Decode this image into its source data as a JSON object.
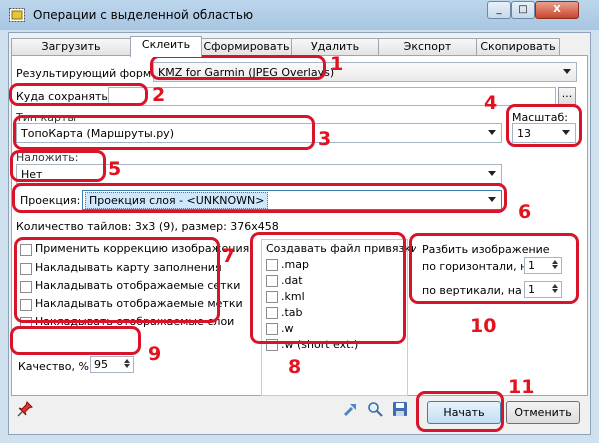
{
  "window": {
    "title": "Операции с выделенной областью",
    "min_btn": "_",
    "max_btn": "□",
    "close_btn": "X"
  },
  "tabs": [
    {
      "label": "Загрузить",
      "active": false
    },
    {
      "label": "Склеить",
      "active": true
    },
    {
      "label": "Сформировать",
      "active": false
    },
    {
      "label": "Удалить",
      "active": false
    },
    {
      "label": "Экспорт",
      "active": false
    },
    {
      "label": "Скопировать",
      "active": false
    }
  ],
  "format": {
    "label": "Результирующий формат",
    "value": "KMZ for Garmin (JPEG Overlays)"
  },
  "save": {
    "label": "Куда сохранять:",
    "value": "",
    "browse": "..."
  },
  "map_type": {
    "label": "Тип карты",
    "value": "ТопоКарта (Маршруты.ру)"
  },
  "scale": {
    "label": "Масштаб:",
    "value": "13"
  },
  "overlay": {
    "label": "Наложить:",
    "value": "Нет"
  },
  "projection": {
    "label": "Проекция:",
    "value": "Проекция слоя - <UNKNOWN>"
  },
  "tiles_info": "Количество тайлов: 3x3 (9), размер: 376x458",
  "options": [
    {
      "label": "Применить коррекцию изображения",
      "checked": false
    },
    {
      "label": "Накладывать карту заполнения",
      "checked": false
    },
    {
      "label": "Накладывать отображаемые сетки",
      "checked": false
    },
    {
      "label": "Накладывать отображаемые метки",
      "checked": false
    },
    {
      "label": "Накладывать отображаемые слои",
      "checked": false
    }
  ],
  "quality": {
    "label": "Качество, %",
    "value": "95"
  },
  "georef": {
    "title": "Создавать файл привязки:",
    "items": [
      {
        "label": ".map",
        "checked": false
      },
      {
        "label": ".dat",
        "checked": false
      },
      {
        "label": ".kml",
        "checked": false
      },
      {
        "label": ".tab",
        "checked": false
      },
      {
        "label": ".w",
        "checked": false
      },
      {
        "label": ".w (short ext.)",
        "checked": false
      }
    ]
  },
  "split": {
    "title": "Разбить изображение",
    "horizontal_label": "по горизонтали, на",
    "horizontal_value": "1",
    "vertical_label": "по вертикали, на",
    "vertical_value": "1"
  },
  "buttons": {
    "start": "Начать",
    "cancel": "Отменить"
  },
  "annotations": [
    "1",
    "2",
    "3",
    "4",
    "5",
    "6",
    "7",
    "8",
    "9",
    "10",
    "11"
  ],
  "colors": {
    "annotation": "#e3121f",
    "window_frame": "#cfe0ee",
    "panel": "#ffffff"
  },
  "icons": [
    "pin-icon",
    "georef-arrow-icon",
    "zoom-icon",
    "save-disk-icon"
  ]
}
